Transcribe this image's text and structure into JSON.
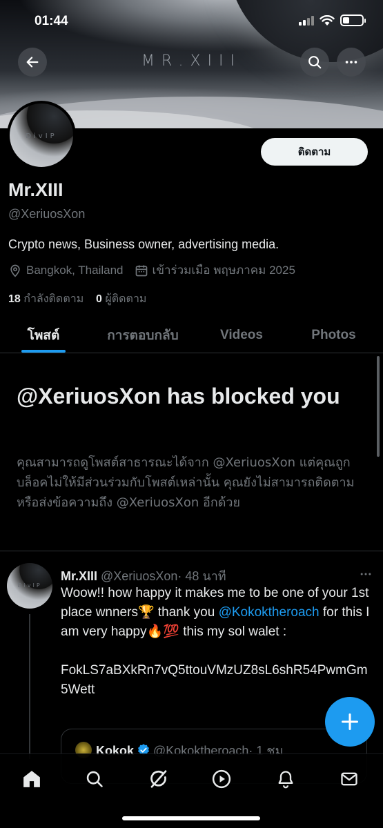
{
  "status_bar": {
    "time": "01:44"
  },
  "banner": {
    "title": "MR.XIII"
  },
  "avatar": {
    "text": "DivIP"
  },
  "profile": {
    "follow_label": "ติดตาม",
    "name": "Mr.XIII",
    "handle": "@XeriuosXon",
    "bio": "Crypto news, Business owner, advertising media.",
    "location": "Bangkok, Thailand",
    "joined": "เข้าร่วมเมือ พฤษภาคม 2025",
    "following_count": "18",
    "following_label": "กำลังติดตาม",
    "followers_count": "0",
    "followers_label": "ผู้ติดตาม"
  },
  "tabs": [
    "โพสต์",
    "การตอบกลับ",
    "Videos",
    "Photos"
  ],
  "blocked": {
    "title": "@XeriuosXon has blocked you",
    "body": "คุณสามารถดูโพสต์สาธารณะได้จาก @XeriuosXon แต่คุณถูกบล็อคไม่ให้มีส่วนร่วมกับโพสต์เหล่านั้น คุณยังไม่สามารถติดตามหรือส่งข้อความถึง @XeriuosXon อีกด้วย"
  },
  "tweet": {
    "avatar_text": "DivIP",
    "name": "Mr.XIII",
    "handle": "@XeriuosXon",
    "time": "· 48 นาที",
    "text_1": "Woow!! how happy it makes me to be one of your 1st place wnners🏆 thank you ",
    "mention": "@Kokoktheroach",
    "text_2": " for this I am very happy🔥💯 this my sol walet :",
    "wallet": "FokLS7aBXkRn7vQ5ttouVMzUZ8sL6shR54PwmGm5Wett",
    "quote": {
      "name": "Kokok",
      "handle": "@Kokoktheroach",
      "time": "· 1 ชม"
    }
  },
  "colors": {
    "accent": "#1d9bf0",
    "muted": "#71767b",
    "text": "#e7e9ea",
    "background": "#000000"
  },
  "icons": [
    "back-arrow-icon",
    "search-icon",
    "more-icon",
    "location-icon",
    "calendar-icon",
    "verified-icon",
    "plus-icon",
    "home-icon",
    "grok-icon",
    "play-icon",
    "bell-icon",
    "mail-icon"
  ]
}
